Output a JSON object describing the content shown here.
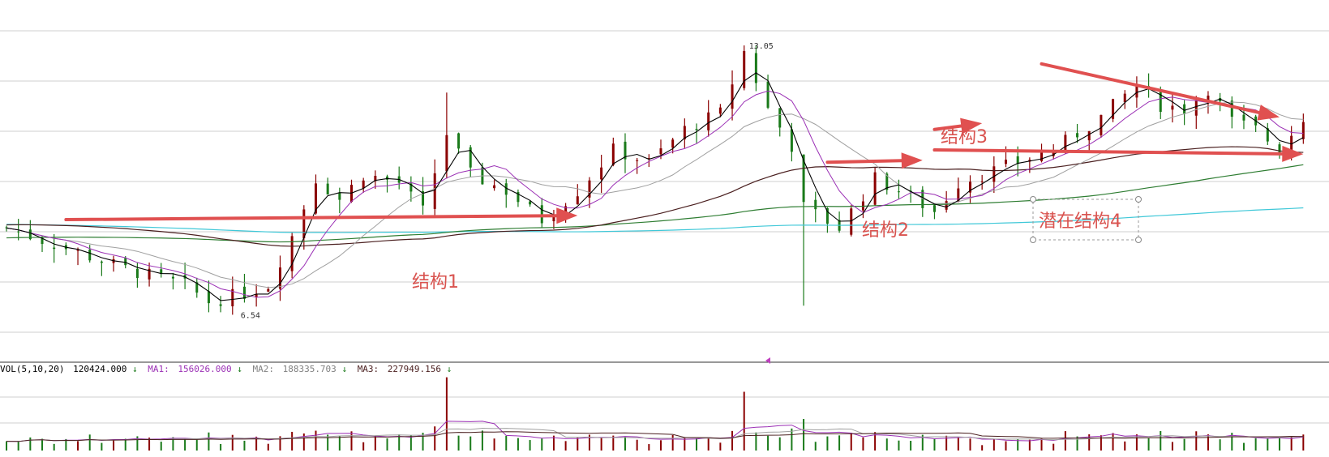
{
  "chart_data": {
    "type": "candlestick",
    "price_panel": {
      "ylim": [
        5.5,
        14.0
      ],
      "max_label": "13.05",
      "min_label": "6.54",
      "ma_series_colors": {
        "ma5": "#000000",
        "ma10": "#9b30b5",
        "ma20": "#a0a0a0",
        "ma60": "#4a1f1f",
        "ma120": "#2e7d32",
        "ma250": "#40c8d8"
      },
      "annotations": [
        {
          "label": "结构1",
          "arrow": [
            5,
            8.8,
            48,
            8.9
          ]
        },
        {
          "label": "结构2",
          "arrow": [
            69,
            10.2,
            77,
            10.25
          ]
        },
        {
          "label": "结构3",
          "arrow": [
            78,
            11.0,
            82,
            11.15
          ]
        },
        {
          "label": "潜在结构4",
          "arrow": [
            78,
            10.5,
            109,
            10.4
          ]
        },
        {
          "label": "",
          "arrow": [
            87,
            12.6,
            107,
            11.3
          ]
        }
      ]
    },
    "volume_panel": {
      "ylim": [
        0,
        600000
      ],
      "label_text": "VOL(5,10,20)",
      "vol_value": "120424.000",
      "ma1_label": "MA1:",
      "ma1_value": "156026.000",
      "ma2_label": "MA2:",
      "ma2_value": "188335.703",
      "ma3_label": "MA3:",
      "ma3_value": "227949.156"
    }
  },
  "colors": {
    "up": "#8b0000",
    "down": "#1a7a1a",
    "grid": "#cfcfcf",
    "arrow": "#e05050",
    "annotation_text": "#d9534f"
  }
}
